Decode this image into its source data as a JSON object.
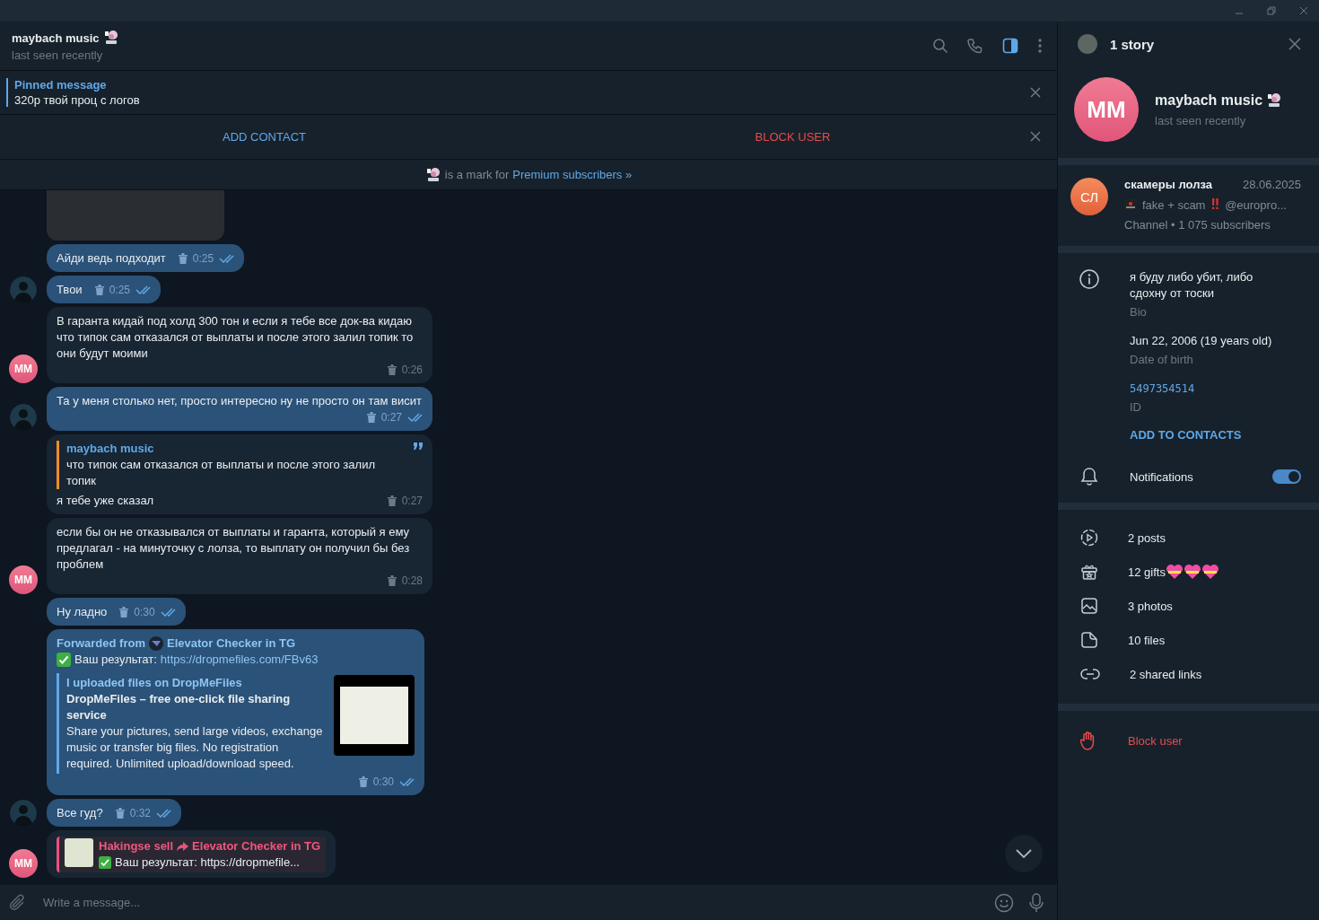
{
  "chat_header": {
    "name": "maybach music",
    "status": "last seen recently"
  },
  "pinned": {
    "label": "Pinned message",
    "text": "320р твой проц с логов"
  },
  "action_bar": {
    "add": "ADD CONTACT",
    "block": "BLOCK USER"
  },
  "premium_notice": {
    "text": "is a mark for",
    "link": "Premium subscribers »"
  },
  "messages": [
    {
      "kind": "image"
    },
    {
      "kind": "text",
      "outgoing": true,
      "text": "Айди ведь подходит",
      "time": "0:25",
      "deleted": true,
      "read": true
    },
    {
      "kind": "text",
      "outgoing": true,
      "text": "Твои",
      "time": "0:25",
      "deleted": true,
      "read": true,
      "avatar": {
        "kind": "photo"
      }
    },
    {
      "kind": "text",
      "outgoing": false,
      "text": "В гаранта кидай под холд 300 тон и если я тебе все док-ва кидаю что типок сам отказался от выплаты и после этого залил топик то они будут моими",
      "time": "0:26",
      "deleted": true,
      "read": false,
      "avatar": {
        "kind": "initials",
        "text": "MM"
      }
    },
    {
      "kind": "text",
      "outgoing": true,
      "text": "Та у меня столько нет, просто интересно ну не просто он там висит",
      "time": "0:27",
      "deleted": true,
      "read": true,
      "avatar": {
        "kind": "photo"
      }
    },
    {
      "kind": "reply",
      "outgoing": false,
      "reply_name": "maybach music",
      "reply_text": "что типок сам отказался от выплаты и после этого залил топик",
      "text": "я тебе уже сказал",
      "time": "0:27",
      "deleted": true,
      "read": false
    },
    {
      "kind": "text",
      "outgoing": false,
      "text": "если бы он не отказывался от выплаты и гаранта, который я ему предлагал - на минуточку с лолза, то выплату он получил бы без проблем",
      "time": "0:28",
      "deleted": true,
      "read": false,
      "avatar": {
        "kind": "initials",
        "text": "MM"
      }
    },
    {
      "kind": "text",
      "outgoing": true,
      "text": "Ну ладно",
      "time": "0:30",
      "deleted": true,
      "read": true
    },
    {
      "kind": "forward",
      "outgoing": true,
      "forwarded_label": "Forwarded from",
      "source": "Elevator Checker in TG",
      "result_label": "Ваш результат:",
      "link": "https://dropmefiles.com/FBv63",
      "preview": {
        "site": "I uploaded files on DropMeFiles",
        "title": "DropMeFiles – free one-click file sharing service",
        "description": "Share your pictures, send large videos, exchange music or transfer big files. No registration required. Unlimited upload/download speed."
      },
      "time": "0:30",
      "deleted": true,
      "read": true
    },
    {
      "kind": "text",
      "outgoing": true,
      "text": "Все гуд?",
      "time": "0:32",
      "deleted": true,
      "read": true,
      "avatar": {
        "kind": "photo"
      }
    },
    {
      "kind": "quote",
      "outgoing": false,
      "sender": "Hakingse sell",
      "source": "Elevator Checker in TG",
      "text": "Ваш результат: https://dropmefile...",
      "avatar": {
        "kind": "initials",
        "text": "MM"
      }
    }
  ],
  "composer": {
    "placeholder": "Write a message..."
  },
  "profile": {
    "story": "1 story",
    "initials": "MM",
    "name": "maybach music",
    "status": "last seen recently",
    "channel": {
      "initials": "СЛ",
      "name": "скамеры лолза",
      "date": "28.06.2025",
      "text": "fake + scam",
      "mark": "‼",
      "handle": "@europro...",
      "meta": "Channel • 1 075 subscribers"
    },
    "info": [
      {
        "value": "я буду либо убит, либо сдохну от тоски",
        "label": "Bio",
        "kind": "bio"
      },
      {
        "value": "Jun 22, 2006 (19 years old)",
        "label": "Date of birth",
        "kind": "plain"
      },
      {
        "value": "5497354514",
        "label": "ID",
        "kind": "id"
      }
    ],
    "add_link": "ADD TO CONTACTS",
    "notifications": {
      "label": "Notifications",
      "on": true
    },
    "media": [
      {
        "kind": "posts",
        "label": "2 posts"
      },
      {
        "kind": "gifts",
        "label": "12 gifts"
      },
      {
        "kind": "photos",
        "label": "3 photos"
      },
      {
        "kind": "files",
        "label": "10 files"
      },
      {
        "kind": "links",
        "label": "2 shared links"
      }
    ],
    "block": "Block user"
  }
}
